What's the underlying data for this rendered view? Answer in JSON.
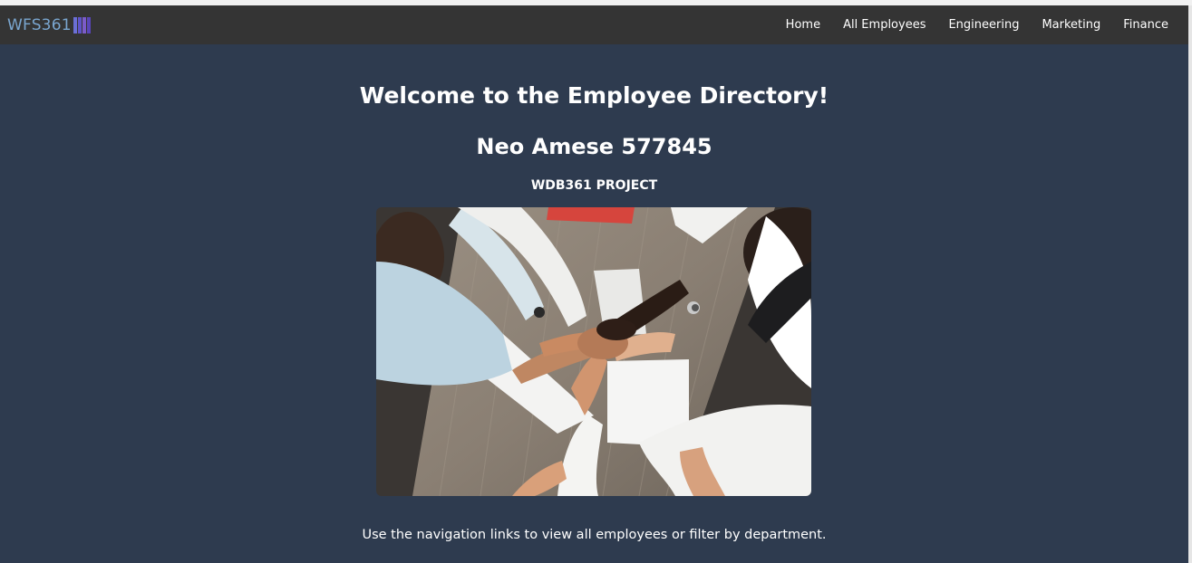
{
  "navbar": {
    "logo_text": "WFS361",
    "links": [
      "Home",
      "All Employees",
      "Engineering",
      "Marketing",
      "Finance"
    ]
  },
  "main": {
    "welcome": "Welcome to the Employee Directory!",
    "author": "Neo Amese 577845",
    "project": "WDB361 PROJECT",
    "instructions": "Use the navigation links to view all employees or filter by department."
  },
  "colors": {
    "navbar_bg": "#343434",
    "page_bg": "#2e3b4f",
    "logo_text": "#7aa6cf",
    "logo_accent": "#5f54c9"
  }
}
